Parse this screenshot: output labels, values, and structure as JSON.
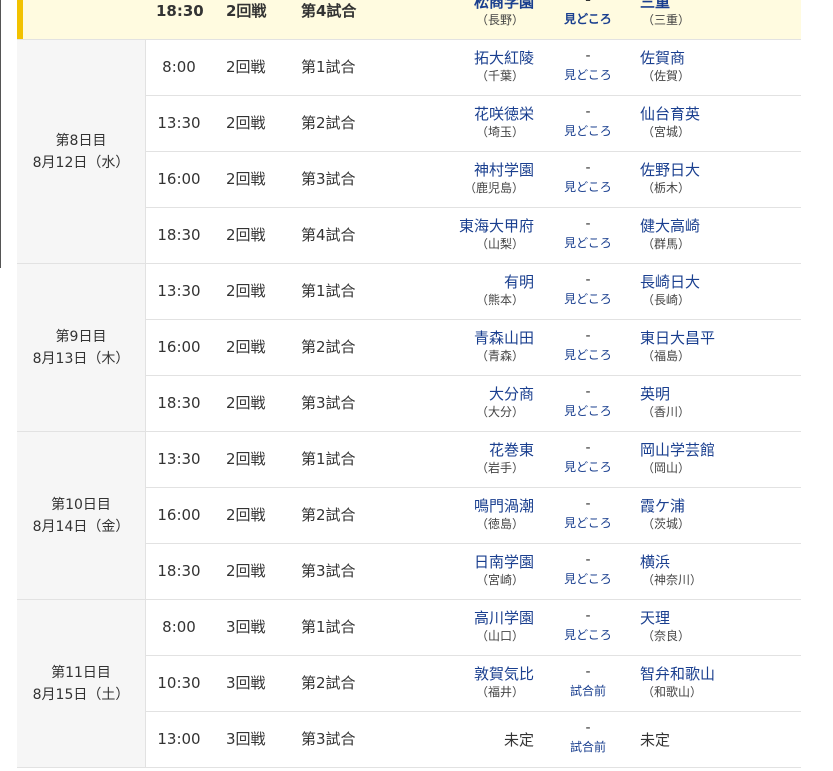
{
  "top_row": {
    "time": "18:30",
    "round": "2回戦",
    "game": "第4試合",
    "team_left": "松商学園",
    "pref_left": "（長野）",
    "dash": "-",
    "link": "見どころ",
    "team_right": "三重",
    "pref_right": "（三重）"
  },
  "days": [
    {
      "day": "第8日目",
      "date": "8月12日（水）",
      "games": [
        {
          "time": "8:00",
          "round": "2回戦",
          "game": "第1試合",
          "team_left": "拓大紅陵",
          "pref_left": "（千葉）",
          "dash": "-",
          "link": "見どころ",
          "team_right": "佐賀商",
          "pref_right": "（佐賀）"
        },
        {
          "time": "13:30",
          "round": "2回戦",
          "game": "第2試合",
          "team_left": "花咲徳栄",
          "pref_left": "（埼玉）",
          "dash": "-",
          "link": "見どころ",
          "team_right": "仙台育英",
          "pref_right": "（宮城）"
        },
        {
          "time": "16:00",
          "round": "2回戦",
          "game": "第3試合",
          "team_left": "神村学園",
          "pref_left": "（鹿児島）",
          "dash": "-",
          "link": "見どころ",
          "team_right": "佐野日大",
          "pref_right": "（栃木）"
        },
        {
          "time": "18:30",
          "round": "2回戦",
          "game": "第4試合",
          "team_left": "東海大甲府",
          "pref_left": "（山梨）",
          "dash": "-",
          "link": "見どころ",
          "team_right": "健大高崎",
          "pref_right": "（群馬）"
        }
      ]
    },
    {
      "day": "第9日目",
      "date": "8月13日（木）",
      "games": [
        {
          "time": "13:30",
          "round": "2回戦",
          "game": "第1試合",
          "team_left": "有明",
          "pref_left": "（熊本）",
          "dash": "-",
          "link": "見どころ",
          "team_right": "長崎日大",
          "pref_right": "（長崎）"
        },
        {
          "time": "16:00",
          "round": "2回戦",
          "game": "第2試合",
          "team_left": "青森山田",
          "pref_left": "（青森）",
          "dash": "-",
          "link": "見どころ",
          "team_right": "東日大昌平",
          "pref_right": "（福島）"
        },
        {
          "time": "18:30",
          "round": "2回戦",
          "game": "第3試合",
          "team_left": "大分商",
          "pref_left": "（大分）",
          "dash": "-",
          "link": "見どころ",
          "team_right": "英明",
          "pref_right": "（香川）"
        }
      ]
    },
    {
      "day": "第10日目",
      "date": "8月14日（金）",
      "games": [
        {
          "time": "13:30",
          "round": "2回戦",
          "game": "第1試合",
          "team_left": "花巻東",
          "pref_left": "（岩手）",
          "dash": "-",
          "link": "見どころ",
          "team_right": "岡山学芸館",
          "pref_right": "（岡山）"
        },
        {
          "time": "16:00",
          "round": "2回戦",
          "game": "第2試合",
          "team_left": "鳴門渦潮",
          "pref_left": "（徳島）",
          "dash": "-",
          "link": "見どころ",
          "team_right": "霞ケ浦",
          "pref_right": "（茨城）"
        },
        {
          "time": "18:30",
          "round": "2回戦",
          "game": "第3試合",
          "team_left": "日南学園",
          "pref_left": "（宮崎）",
          "dash": "-",
          "link": "見どころ",
          "team_right": "横浜",
          "pref_right": "（神奈川）"
        }
      ]
    },
    {
      "day": "第11日目",
      "date": "8月15日（土）",
      "games": [
        {
          "time": "8:00",
          "round": "3回戦",
          "game": "第1試合",
          "team_left": "高川学園",
          "pref_left": "（山口）",
          "dash": "-",
          "link": "見どころ",
          "team_right": "天理",
          "pref_right": "（奈良）"
        },
        {
          "time": "10:30",
          "round": "3回戦",
          "game": "第2試合",
          "team_left": "敦賀気比",
          "pref_left": "（福井）",
          "dash": "-",
          "link": "試合前",
          "team_right": "智弁和歌山",
          "pref_right": "（和歌山）"
        },
        {
          "time": "13:00",
          "round": "3回戦",
          "game": "第3試合",
          "team_left": "未定",
          "pref_left": "",
          "dash": "-",
          "link": "試合前",
          "team_right": "未定",
          "pref_right": ""
        }
      ]
    }
  ]
}
